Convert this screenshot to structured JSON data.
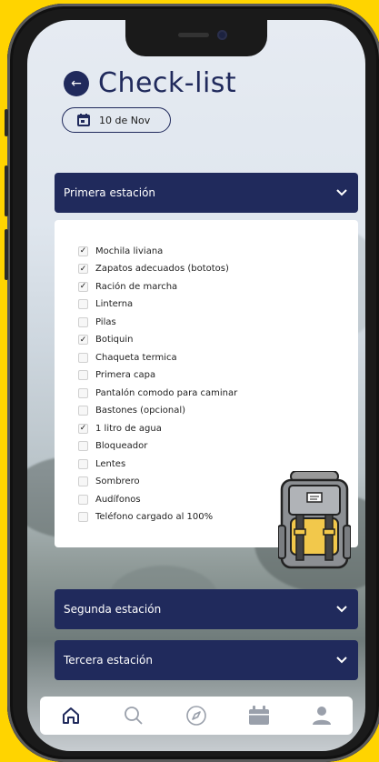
{
  "header": {
    "title": "Check-list",
    "back_icon": "arrow-left-icon"
  },
  "date": {
    "label": "10 de Nov",
    "icon": "calendar-icon"
  },
  "sections": [
    {
      "label": "Primera estación",
      "expanded": true
    },
    {
      "label": "Segunda estación",
      "expanded": false
    },
    {
      "label": "Tercera estación",
      "expanded": false
    }
  ],
  "checklist": [
    {
      "label": "Mochila liviana",
      "checked": true
    },
    {
      "label": "Zapatos adecuados (bototos)",
      "checked": true
    },
    {
      "label": "Ración de marcha",
      "checked": true
    },
    {
      "label": "Linterna",
      "checked": false
    },
    {
      "label": "Pilas",
      "checked": false
    },
    {
      "label": "Botiquin",
      "checked": true
    },
    {
      "label": "Chaqueta termica",
      "checked": false
    },
    {
      "label": "Primera capa",
      "checked": false
    },
    {
      "label": "Pantalón comodo para caminar",
      "checked": false
    },
    {
      "label": "Bastones (opcional)",
      "checked": false
    },
    {
      "label": "1 litro de agua",
      "checked": true
    },
    {
      "label": "Bloqueador",
      "checked": false
    },
    {
      "label": "Lentes",
      "checked": false
    },
    {
      "label": "Sombrero",
      "checked": false
    },
    {
      "label": "Audífonos",
      "checked": false
    },
    {
      "label": "Teléfono cargado al 100%",
      "checked": false
    }
  ],
  "nav": [
    "home-icon",
    "search-icon",
    "compass-icon",
    "calendar-icon",
    "profile-icon"
  ],
  "colors": {
    "primary": "#202a5c",
    "frame_bg": "#FFD400",
    "card": "#ffffff"
  }
}
